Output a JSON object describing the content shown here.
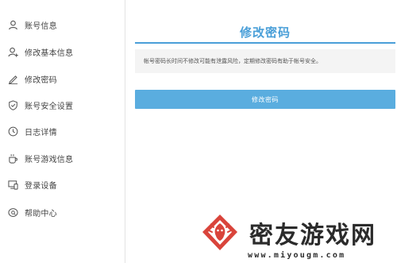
{
  "sidebar": {
    "items": [
      {
        "label": "账号信息",
        "icon": "user-icon"
      },
      {
        "label": "修改基本信息",
        "icon": "user-edit-icon"
      },
      {
        "label": "修改密码",
        "icon": "pen-icon"
      },
      {
        "label": "账号安全设置",
        "icon": "shield-icon"
      },
      {
        "label": "日志详情",
        "icon": "clock-icon"
      },
      {
        "label": "账号游戏信息",
        "icon": "cup-icon"
      },
      {
        "label": "登录设备",
        "icon": "device-icon"
      },
      {
        "label": "帮助中心",
        "icon": "help-icon"
      }
    ]
  },
  "main": {
    "title": "修改密码",
    "notice": "帐号密码长时间不修改可能有泄露风险，定期修改密码有助于帐号安全。",
    "submit_label": "修改密码"
  },
  "watermark": {
    "name": "密友游戏网",
    "domain": "www.miyougm.com"
  },
  "colors": {
    "accent": "#4a9fd8",
    "button": "#5aaddf",
    "logo_red": "#d9443b"
  }
}
